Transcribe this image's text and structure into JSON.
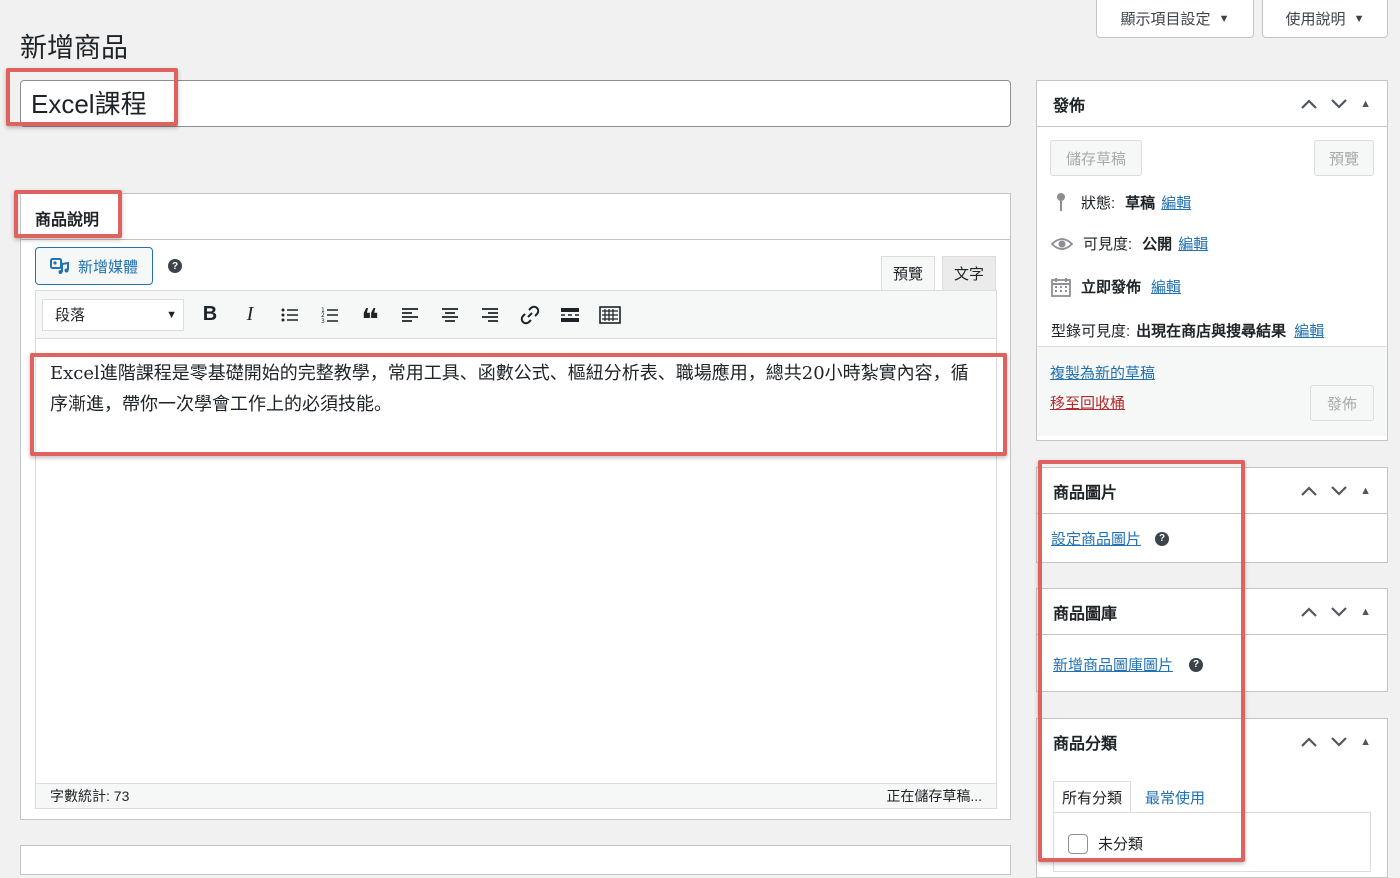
{
  "top_buttons": {
    "screen_options": "顯示項目設定",
    "help": "使用說明"
  },
  "page_title": "新增商品",
  "product_title": "Excel課程",
  "description": {
    "header": "商品說明",
    "add_media": "新增媒體",
    "tabs": {
      "visual": "預覽",
      "text": "文字"
    },
    "format_select": "段落",
    "content": "Excel進階課程是零基礎開始的完整教學，常用工具、函數公式、樞紐分析表、職場應用，總共20小時紮實內容，循序漸進，帶你一次學會工作上的必須技能。",
    "word_count": "字數統計: 73",
    "saving_status": "正在儲存草稿..."
  },
  "publish": {
    "title": "發佈",
    "save_draft": "儲存草稿",
    "preview": "預覽",
    "status_label": "狀態:",
    "status_value": "草稿",
    "visibility_label": "可見度:",
    "visibility_value": "公開",
    "publish_label": "立即發佈",
    "catalog_label": "型錄可見度:",
    "catalog_value": "出現在商店與搜尋結果",
    "edit": "編輯",
    "copy_draft": "複製為新的草稿",
    "trash": "移至回收桶",
    "publish_button": "發佈"
  },
  "product_image": {
    "title": "商品圖片",
    "link": "設定商品圖片"
  },
  "product_gallery": {
    "title": "商品圖庫",
    "link": "新增商品圖庫圖片"
  },
  "product_categories": {
    "title": "商品分類",
    "tab_all": "所有分類",
    "tab_popular": "最常使用",
    "items": [
      "未分類"
    ]
  },
  "colors": {
    "accent": "#2271b1",
    "highlight": "#e0625e",
    "trash": "#b32d2e"
  }
}
